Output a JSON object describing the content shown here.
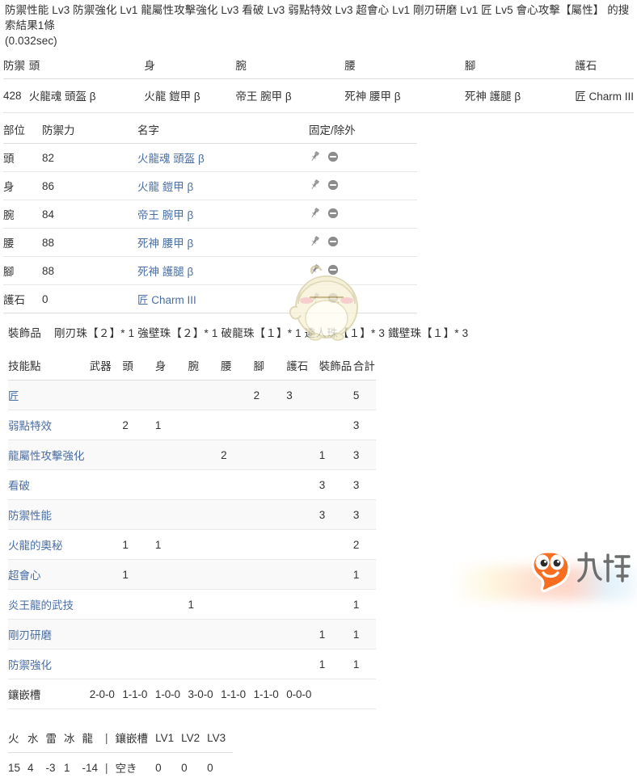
{
  "search": {
    "summary_line1": "防禦性能 Lv3 防禦強化 Lv1 龍屬性攻擊強化 Lv3 看破 Lv3 弱點特效 Lv3 超會心 Lv1 剛刃研磨 Lv1 匠 Lv5 會心攻擊【屬性】 的搜索結果1條",
    "summary_line2": "(0.032sec)"
  },
  "armor_set": {
    "headers": [
      "防禦",
      "頭",
      "身",
      "腕",
      "腰",
      "腳",
      "護石"
    ],
    "row": [
      "428",
      "火龍魂 頭盔 β",
      "火龍 鎧甲 β",
      "帝王 腕甲 β",
      "死神 腰甲 β",
      "死神 護腿 β",
      "匠 Charm III"
    ]
  },
  "pieces": {
    "headers": [
      "部位",
      "防禦力",
      "名字",
      "固定/除外"
    ],
    "rows": [
      {
        "part": "頭",
        "defense": "82",
        "name": "火龍魂 頭盔 β"
      },
      {
        "part": "身",
        "defense": "86",
        "name": "火龍 鎧甲 β"
      },
      {
        "part": "腕",
        "defense": "84",
        "name": "帝王 腕甲 β"
      },
      {
        "part": "腰",
        "defense": "88",
        "name": "死神 腰甲 β"
      },
      {
        "part": "腳",
        "defense": "88",
        "name": "死神 護腿 β"
      },
      {
        "part": "護石",
        "defense": "0",
        "name": "匠 Charm III"
      }
    ],
    "pin_icon": "pin-icon",
    "exclude_icon": "minus-circle-icon"
  },
  "decorations": {
    "label": "裝飾品",
    "value": "剛刃珠【２】* 1 強壁珠【２】* 1 破龍珠【１】* 1 達人珠【１】* 3 鐵壁珠【１】* 3"
  },
  "skills": {
    "headers": [
      "技能點",
      "武器",
      "頭",
      "身",
      "腕",
      "腰",
      "腳",
      "護石",
      "裝飾品",
      "合計"
    ],
    "rows": [
      {
        "name": "匠",
        "weapon": "",
        "head": "",
        "body": "",
        "arm": "",
        "waist": "",
        "leg": "2",
        "charm": "3",
        "deco": "",
        "total": "5"
      },
      {
        "name": "弱點特效",
        "weapon": "",
        "head": "2",
        "body": "1",
        "arm": "",
        "waist": "",
        "leg": "",
        "charm": "",
        "deco": "",
        "total": "3"
      },
      {
        "name": "龍屬性攻擊強化",
        "weapon": "",
        "head": "",
        "body": "",
        "arm": "",
        "waist": "2",
        "leg": "",
        "charm": "",
        "deco": "1",
        "total": "3"
      },
      {
        "name": "看破",
        "weapon": "",
        "head": "",
        "body": "",
        "arm": "",
        "waist": "",
        "leg": "",
        "charm": "",
        "deco": "3",
        "total": "3"
      },
      {
        "name": "防禦性能",
        "weapon": "",
        "head": "",
        "body": "",
        "arm": "",
        "waist": "",
        "leg": "",
        "charm": "",
        "deco": "3",
        "total": "3"
      },
      {
        "name": "火龍的奧秘",
        "weapon": "",
        "head": "1",
        "body": "1",
        "arm": "",
        "waist": "",
        "leg": "",
        "charm": "",
        "deco": "",
        "total": "2"
      },
      {
        "name": "超會心",
        "weapon": "",
        "head": "1",
        "body": "",
        "arm": "",
        "waist": "",
        "leg": "",
        "charm": "",
        "deco": "",
        "total": "1"
      },
      {
        "name": "炎王龍的武技",
        "weapon": "",
        "head": "",
        "body": "",
        "arm": "1",
        "waist": "",
        "leg": "",
        "charm": "",
        "deco": "",
        "total": "1"
      },
      {
        "name": "剛刃研磨",
        "weapon": "",
        "head": "",
        "body": "",
        "arm": "",
        "waist": "",
        "leg": "",
        "charm": "",
        "deco": "1",
        "total": "1"
      },
      {
        "name": "防禦強化",
        "weapon": "",
        "head": "",
        "body": "",
        "arm": "",
        "waist": "",
        "leg": "",
        "charm": "",
        "deco": "1",
        "total": "1"
      }
    ],
    "slots_row": {
      "label": "鑲嵌槽",
      "values": [
        "2-0-0",
        "1-1-0",
        "1-0-0",
        "3-0-0",
        "1-1-0",
        "1-1-0",
        "0-0-0"
      ]
    }
  },
  "resistances": {
    "headers": [
      "火",
      "水",
      "雷",
      "冰",
      "龍",
      "|",
      "鑲嵌槽",
      "LV1",
      "LV2",
      "LV3"
    ],
    "values": [
      "15",
      "4",
      "-3",
      "1",
      "-14",
      "|",
      "空き",
      "0",
      "0",
      "0"
    ]
  },
  "watermark": {
    "brand": "九游",
    "mascot": "mascot-icon"
  },
  "colors": {
    "link": "#4a6fa5",
    "text": "#333333",
    "rule": "#dddddd",
    "stripe": "#f9f9f9",
    "brand_orange": "#f96d21"
  }
}
